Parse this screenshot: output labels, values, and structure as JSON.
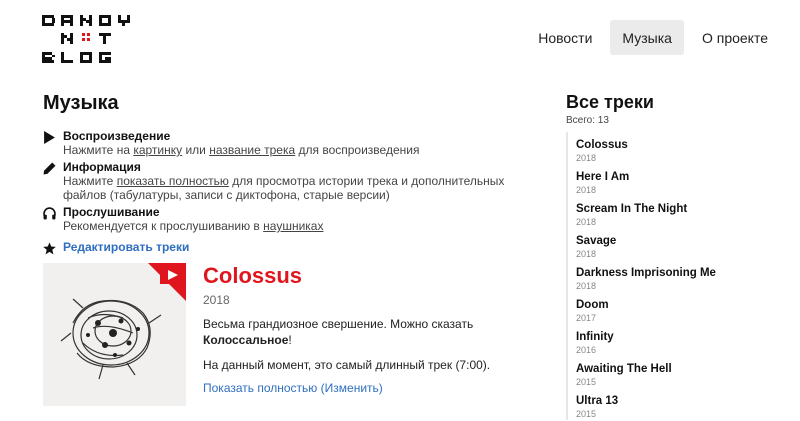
{
  "header": {
    "logo_text": "DANDY NIT BLOG",
    "nav": [
      {
        "label": "Новости"
      },
      {
        "label": "Музыка"
      },
      {
        "label": "О проекте"
      }
    ]
  },
  "main": {
    "title": "Музыка",
    "help": {
      "play": {
        "title": "Воспроизведение",
        "pre": "Нажмите на ",
        "link1": "картинку",
        "mid": " или ",
        "link2": "название трека",
        "post": " для воспроизведения"
      },
      "info": {
        "title": "Информация",
        "pre": "Нажмите ",
        "link": "показать полностью",
        "post": " для просмотра истории трека и дополнительных файлов (табулатуры, записи с диктофона, старые версии)"
      },
      "listen": {
        "title": "Прослушивание",
        "pre": "Рекомендуется к прослушиванию в ",
        "link": "наушниках"
      },
      "edit_label": "Редактировать треки"
    },
    "featured": {
      "title": "Colossus",
      "year": "2018",
      "desc_pre": "Весьма грандиозное свершение. Можно сказать ",
      "desc_bold": "Колоссальное",
      "desc_post": "!",
      "note": "На данный момент, это самый длинный трек (7:00).",
      "show_full": "Показать полностью",
      "edit": "(Изменить)"
    }
  },
  "sidebar": {
    "title": "Все треки",
    "count": "Всего: 13",
    "tracks": [
      {
        "name": "Colossus",
        "year": "2018"
      },
      {
        "name": "Here I Am",
        "year": "2018"
      },
      {
        "name": "Scream In The Night",
        "year": "2018"
      },
      {
        "name": "Savage",
        "year": "2018"
      },
      {
        "name": "Darkness Imprisoning Me",
        "year": "2018"
      },
      {
        "name": "Doom",
        "year": "2017"
      },
      {
        "name": "Infinity",
        "year": "2016"
      },
      {
        "name": "Awaiting The Hell",
        "year": "2015"
      },
      {
        "name": "Ultra 13",
        "year": "2015"
      }
    ]
  },
  "colors": {
    "accent_red": "#e0161f",
    "link_blue": "#2f6fc0",
    "nav_active_bg": "#ebebeb"
  }
}
